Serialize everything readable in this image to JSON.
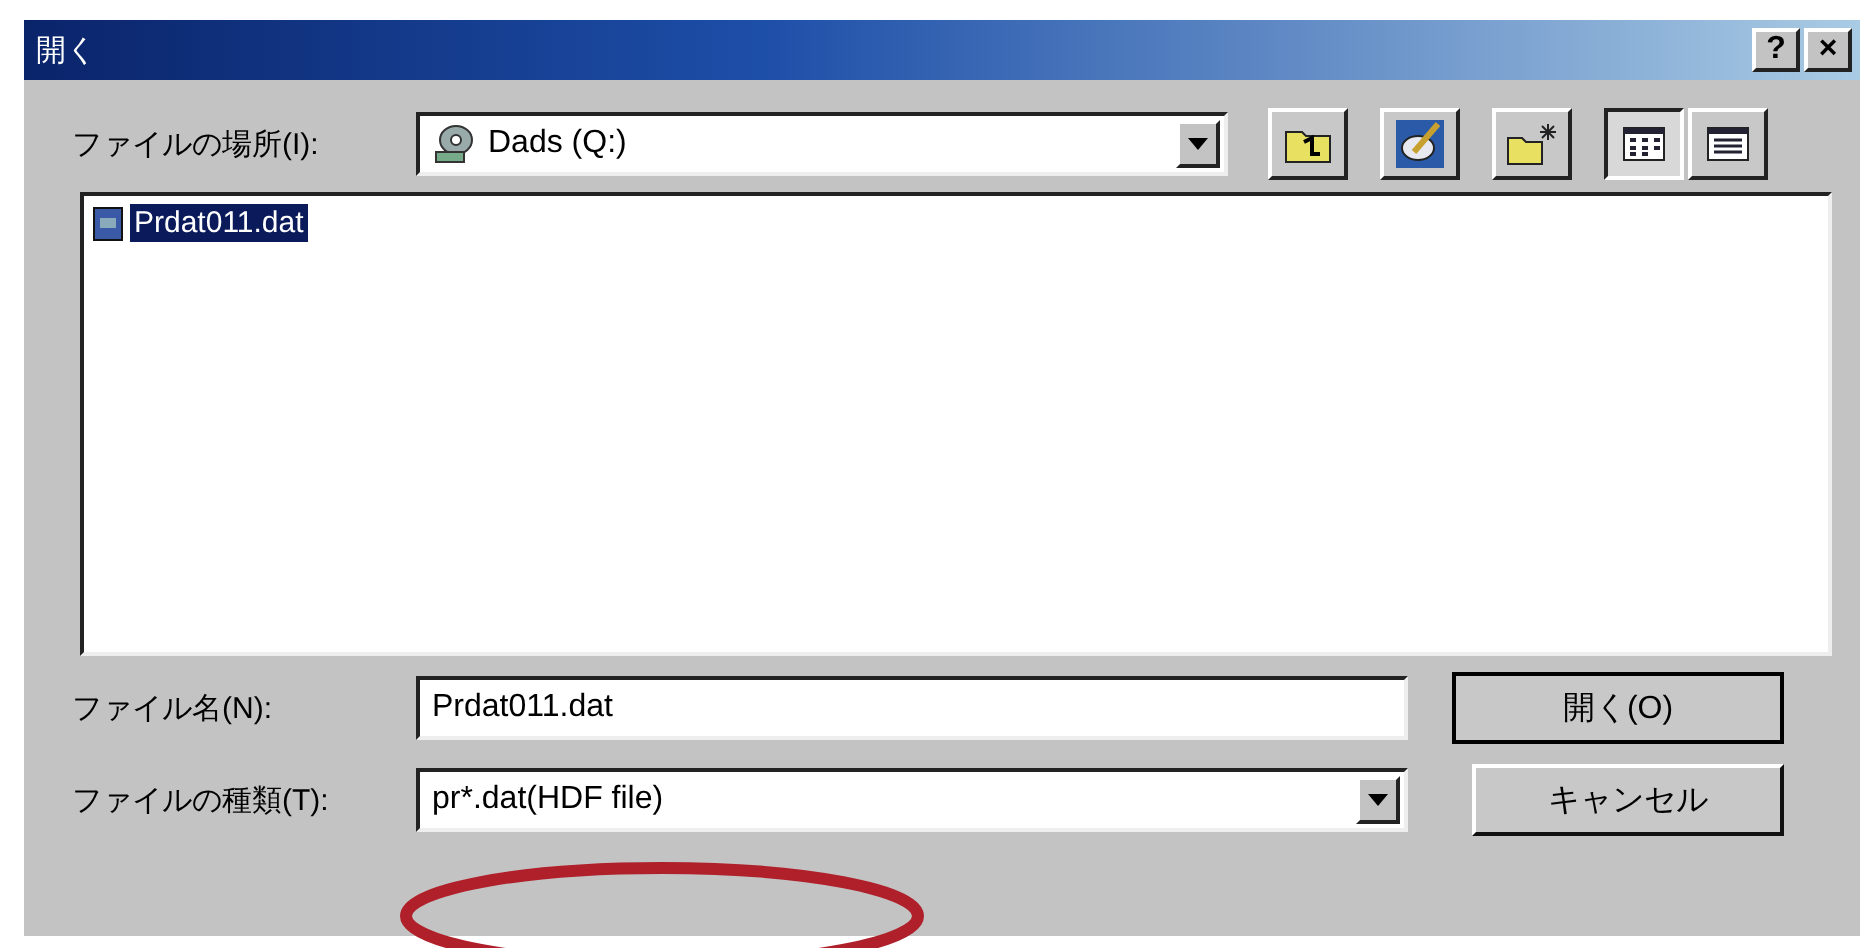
{
  "window": {
    "title": "開く",
    "help_button": "?",
    "close_button": "×"
  },
  "look_in": {
    "label": "ファイルの場所(I):",
    "value": "Dads (Q:)"
  },
  "views": [
    {
      "selected": true
    },
    {
      "selected": false
    }
  ],
  "files": [
    {
      "name": "Prdat011.dat",
      "selected": true
    }
  ],
  "file_name": {
    "label": "ファイル名(N):",
    "value": "Prdat011.dat"
  },
  "file_type": {
    "label": "ファイルの種類(T):",
    "value": "pr*.dat(HDF file)"
  },
  "buttons": [
    "開く(O)",
    "キャンセル"
  ]
}
